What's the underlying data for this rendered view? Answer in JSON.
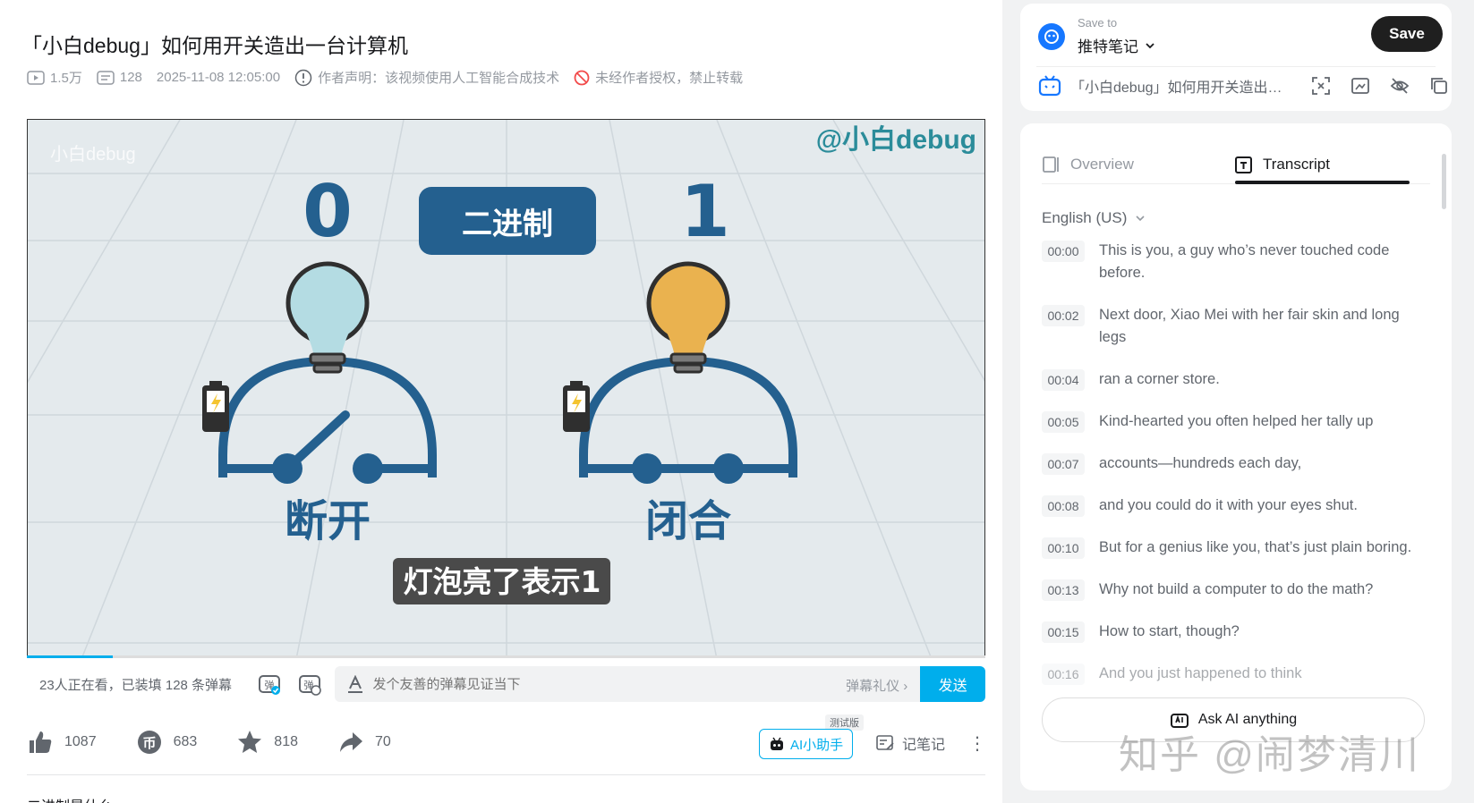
{
  "video": {
    "title": "「小白debug」如何用开关造出一台计算机",
    "views": "1.5万",
    "danmaku_count": "128",
    "date": "2025-11-08 12:05:00",
    "statement": "作者声明：该视频使用人工智能合成技术",
    "copyright": "未经作者授权，禁止转载"
  },
  "player": {
    "channel_mark": "@小白debug",
    "faint_mark": "小白debug",
    "left_digit": "0",
    "right_digit": "1",
    "badge": "二进制",
    "left_label": "断开",
    "right_label": "闭合",
    "subtitle": "灯泡亮了表示1",
    "progress": 0.09
  },
  "danmaku": {
    "viewers_text": "23人正在看，已装填 128 条弹幕",
    "placeholder": "发个友善的弹幕见证当下",
    "etiquette": "弹幕礼仪 ›",
    "send": "发送"
  },
  "actions": {
    "like": "1087",
    "coin": "683",
    "favorite": "818",
    "share": "70",
    "ai_assistant": "AI小助手",
    "ai_beta": "测试版",
    "note": "记笔记"
  },
  "description_peek": "二进制是什么",
  "save_panel": {
    "save_to_label": "Save to",
    "target": "推特笔记",
    "save_button": "Save",
    "item_title": "「小白debug」如何用开关造出一台计算机"
  },
  "transcript_panel": {
    "tab_overview": "Overview",
    "tab_transcript": "Transcript",
    "language": "English (US)",
    "lines": [
      {
        "time": "00:00",
        "text": "This is you, a guy who’s never touched code before."
      },
      {
        "time": "00:02",
        "text": "Next door, Xiao Mei with her fair skin and long legs"
      },
      {
        "time": "00:04",
        "text": "ran a corner store."
      },
      {
        "time": "00:05",
        "text": "Kind-hearted you often helped her tally up"
      },
      {
        "time": "00:07",
        "text": "accounts—hundreds each day,"
      },
      {
        "time": "00:08",
        "text": "and you could do it with your eyes shut."
      },
      {
        "time": "00:10",
        "text": "But for a genius like you, that’s just plain boring."
      },
      {
        "time": "00:13",
        "text": "Why not build a computer to do the math?"
      },
      {
        "time": "00:15",
        "text": "How to start, though?"
      },
      {
        "time": "00:16",
        "text": "And you just happened to think"
      }
    ],
    "ask_ai": "Ask AI anything"
  },
  "watermark": "知乎 @闹梦清川",
  "colors": {
    "accent": "#00aeec",
    "player_blue": "#24608f",
    "bulb_off": "#b4dce3",
    "bulb_on": "#eab24f"
  }
}
